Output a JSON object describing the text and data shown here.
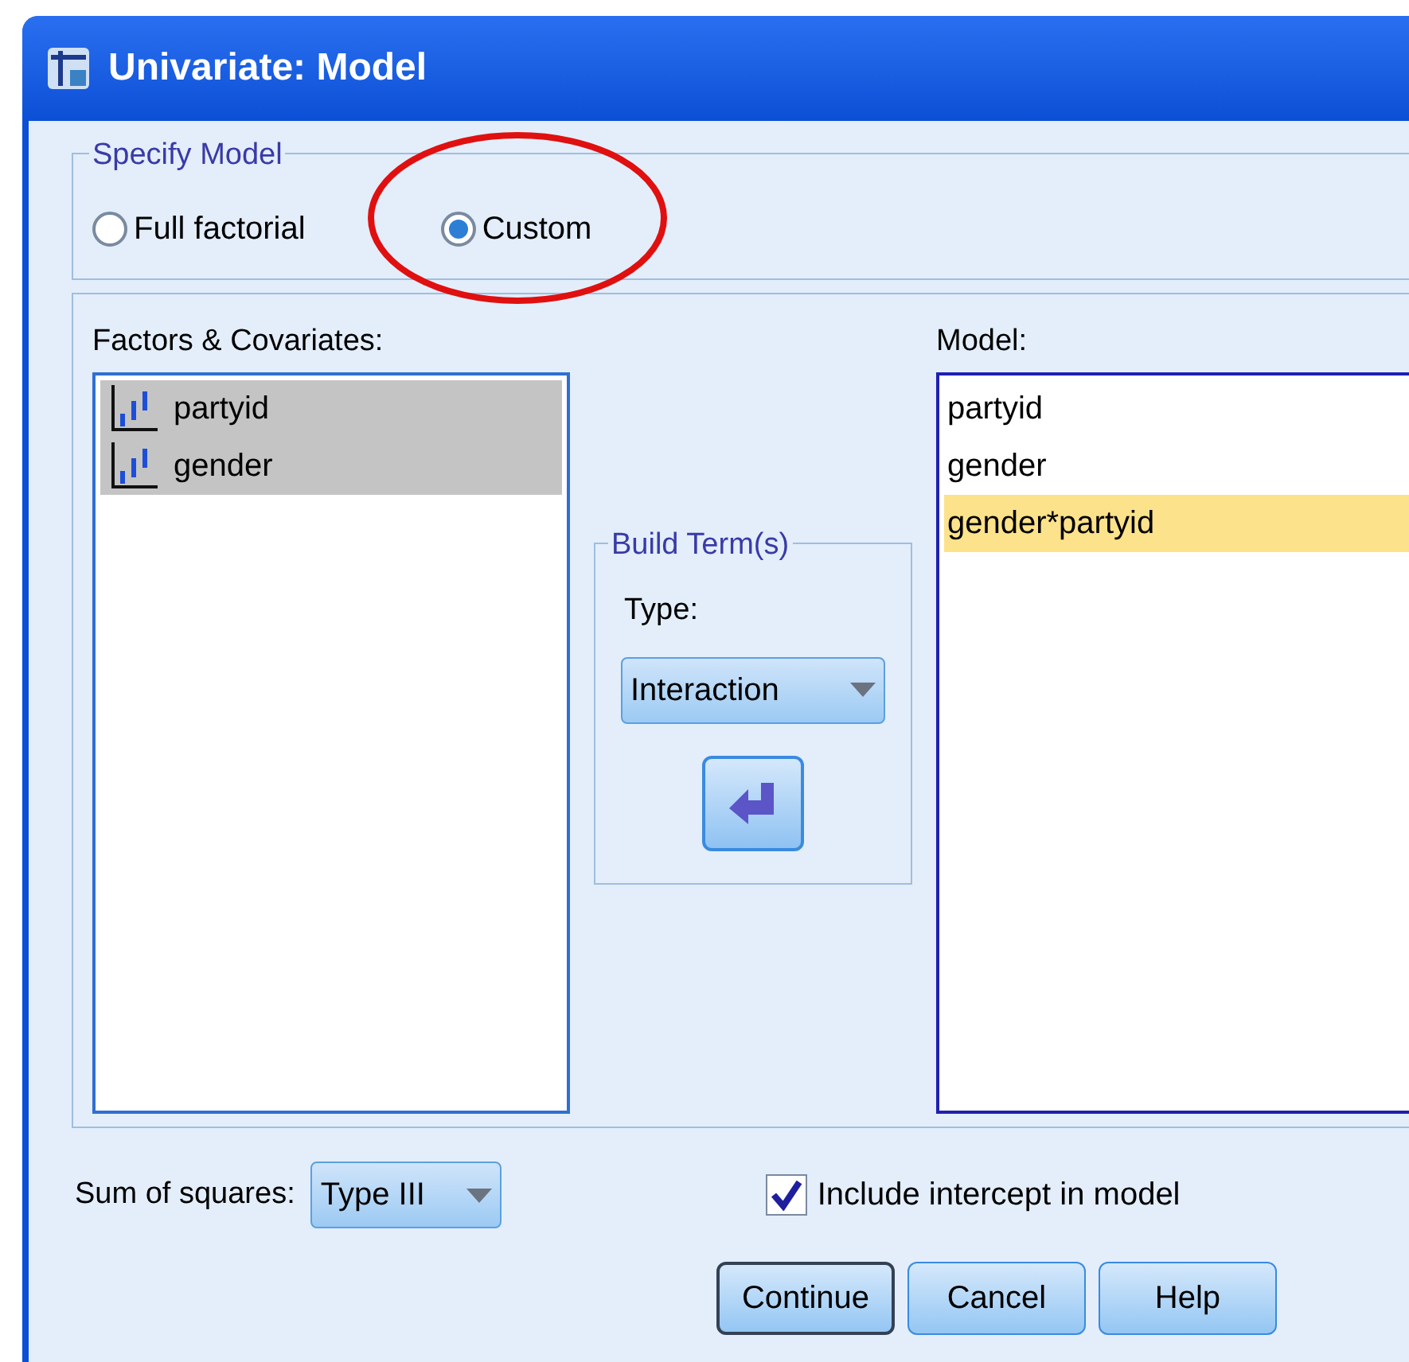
{
  "window": {
    "title": "Univariate: Model"
  },
  "specify_model": {
    "label": "Specify Model",
    "options": [
      {
        "label": "Full factorial",
        "selected": false
      },
      {
        "label": "Custom",
        "selected": true
      }
    ]
  },
  "factors": {
    "label": "Factors & Covariates:",
    "items": [
      {
        "name": "partyid",
        "selected": true
      },
      {
        "name": "gender",
        "selected": true
      }
    ]
  },
  "build_terms": {
    "label": "Build Term(s)",
    "type_label": "Type:",
    "type_value": "Interaction"
  },
  "model": {
    "label": "Model:",
    "items": [
      {
        "name": "partyid",
        "selected": false
      },
      {
        "name": "gender",
        "selected": false
      },
      {
        "name": "gender*partyid",
        "selected": true
      }
    ]
  },
  "sum_of_squares": {
    "label": "Sum of squares:",
    "value": "Type III"
  },
  "include_intercept": {
    "label": "Include intercept in model",
    "checked": true
  },
  "buttons": [
    {
      "label": "Continue",
      "default": true
    },
    {
      "label": "Cancel",
      "default": false
    },
    {
      "label": "Help",
      "default": false
    }
  ]
}
